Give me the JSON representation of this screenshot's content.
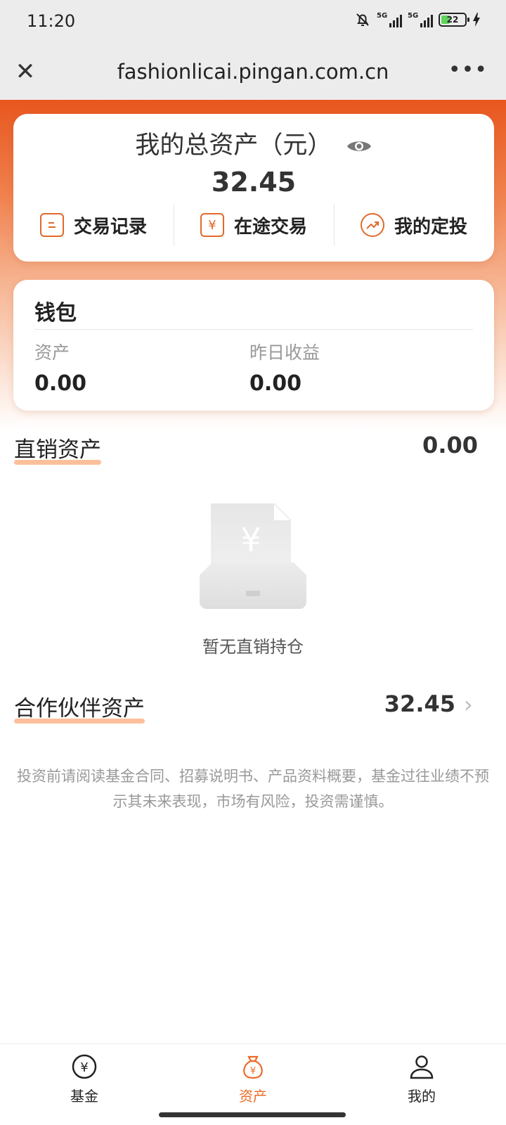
{
  "status_bar": {
    "time": "11:20",
    "network_1": "5G",
    "network_2": "5G",
    "battery": "22"
  },
  "nav": {
    "close_icon": "close-icon",
    "title": "fashionlicai.pingan.com.cn",
    "more_icon": "more-icon"
  },
  "asset_card": {
    "title": "我的总资产（元）",
    "amount": "32.45",
    "actions": [
      {
        "label": "交易记录",
        "icon": "list-icon"
      },
      {
        "label": "在途交易",
        "icon": "yuan-icon"
      },
      {
        "label": "我的定投",
        "icon": "trend-icon"
      }
    ]
  },
  "wallet": {
    "title": "钱包",
    "asset_label": "资产",
    "asset_value": "0.00",
    "yesterday_label": "昨日收益",
    "yesterday_value": "0.00"
  },
  "direct": {
    "title": "直销资产",
    "value": "0.00",
    "empty_text": "暂无直销持仓"
  },
  "partner": {
    "title": "合作伙伴资产",
    "value": "32.45"
  },
  "disclaimer": "投资前请阅读基金合同、招募说明书、产品资料概要，基金过往业绩不预示其未来表现，市场有风险，投资需谨慎。",
  "tabs": [
    {
      "label": "基金",
      "icon": "fund-icon"
    },
    {
      "label": "资产",
      "icon": "moneybag-icon",
      "active": true
    },
    {
      "label": "我的",
      "icon": "user-icon"
    }
  ],
  "colors": {
    "accent": "#ec6a24",
    "hero_top": "#e8561f",
    "underline": "#fbc09b"
  }
}
